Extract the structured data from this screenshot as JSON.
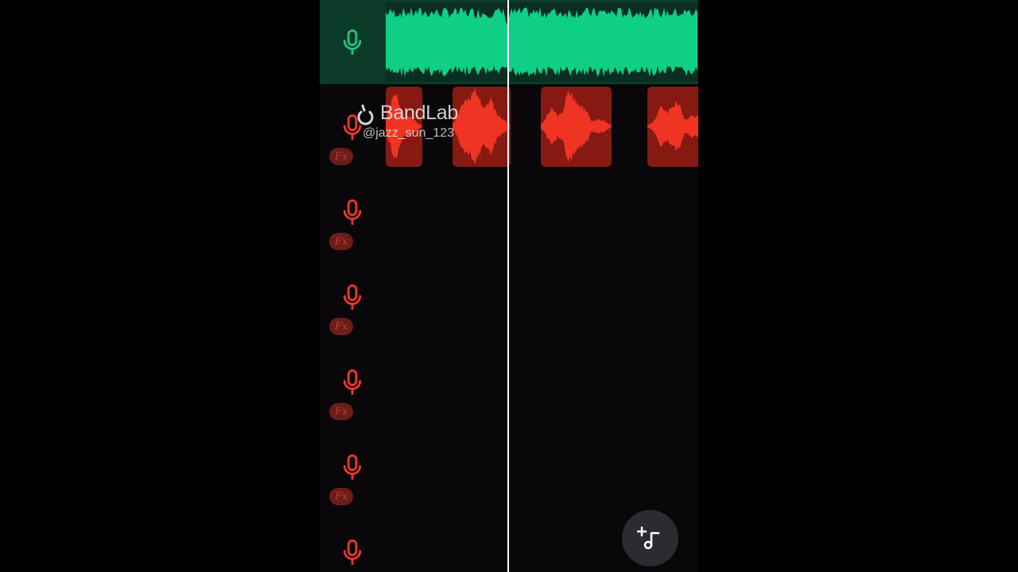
{
  "watermark": {
    "brand": "BandLab",
    "handle": "@jazz_sun_123",
    "icon": "bandlab-logo-icon"
  },
  "tracks": [
    {
      "icon": "microphone-icon",
      "state": "selected",
      "color": "#27c07a",
      "fx": null
    },
    {
      "icon": "microphone-icon",
      "color": "#e8372c",
      "fx": "Fx"
    },
    {
      "icon": "microphone-icon",
      "color": "#e8372c",
      "fx": "Fx"
    },
    {
      "icon": "microphone-icon",
      "color": "#e8372c",
      "fx": "Fx"
    },
    {
      "icon": "microphone-icon",
      "color": "#e8372c",
      "fx": "Fx"
    },
    {
      "icon": "microphone-icon",
      "color": "#e8372c",
      "fx": "Fx"
    },
    {
      "icon": "microphone-icon",
      "color": "#e8372c",
      "fx": null
    }
  ],
  "add_track_button": {
    "icon": "add-music-note-icon"
  },
  "colors": {
    "background": "#09070a",
    "selected_track": "#0c3b2a",
    "green_wave": "#0fcf86",
    "red_clip": "#861a12",
    "red_wave": "#ef3424",
    "playhead": "#ffffff"
  }
}
